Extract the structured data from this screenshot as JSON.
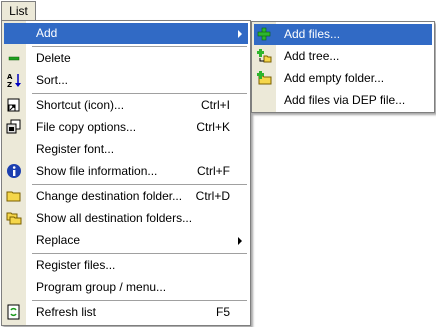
{
  "menubar": {
    "list_label": "List"
  },
  "main_menu": {
    "items": [
      {
        "label": "Add",
        "shortcut": "",
        "icon": "none",
        "has_submenu": true
      },
      {
        "label": "Delete",
        "shortcut": "",
        "icon": "minus-icon"
      },
      {
        "label": "Sort...",
        "shortcut": "",
        "icon": "sort-az-icon"
      },
      {
        "label": "Shortcut (icon)...",
        "shortcut": "Ctrl+I",
        "icon": "shortcut-icon"
      },
      {
        "label": "File copy options...",
        "shortcut": "Ctrl+K",
        "icon": "copy-options-icon"
      },
      {
        "label": "Register font...",
        "shortcut": "",
        "icon": "none"
      },
      {
        "label": "Show file information...",
        "shortcut": "Ctrl+F",
        "icon": "info-icon"
      },
      {
        "label": "Change destination folder...",
        "shortcut": "Ctrl+D",
        "icon": "folder-icon"
      },
      {
        "label": "Show all destination folders...",
        "shortcut": "",
        "icon": "folders-icon"
      },
      {
        "label": "Replace",
        "shortcut": "",
        "icon": "none",
        "has_submenu": true
      },
      {
        "label": "Register files...",
        "shortcut": "",
        "icon": "none"
      },
      {
        "label": "Program group / menu...",
        "shortcut": "",
        "icon": "none"
      },
      {
        "label": "Refresh list",
        "shortcut": "F5",
        "icon": "refresh-icon"
      }
    ]
  },
  "sub_menu": {
    "items": [
      {
        "label": "Add files...",
        "icon": "add-files-icon"
      },
      {
        "label": "Add tree...",
        "icon": "add-tree-icon"
      },
      {
        "label": "Add empty folder...",
        "icon": "add-folder-icon"
      },
      {
        "label": "Add files via DEP file...",
        "icon": "none"
      }
    ]
  },
  "colors": {
    "highlight": "#316ac5",
    "gutter": "#ece9d8",
    "border": "#7f7f7f"
  }
}
